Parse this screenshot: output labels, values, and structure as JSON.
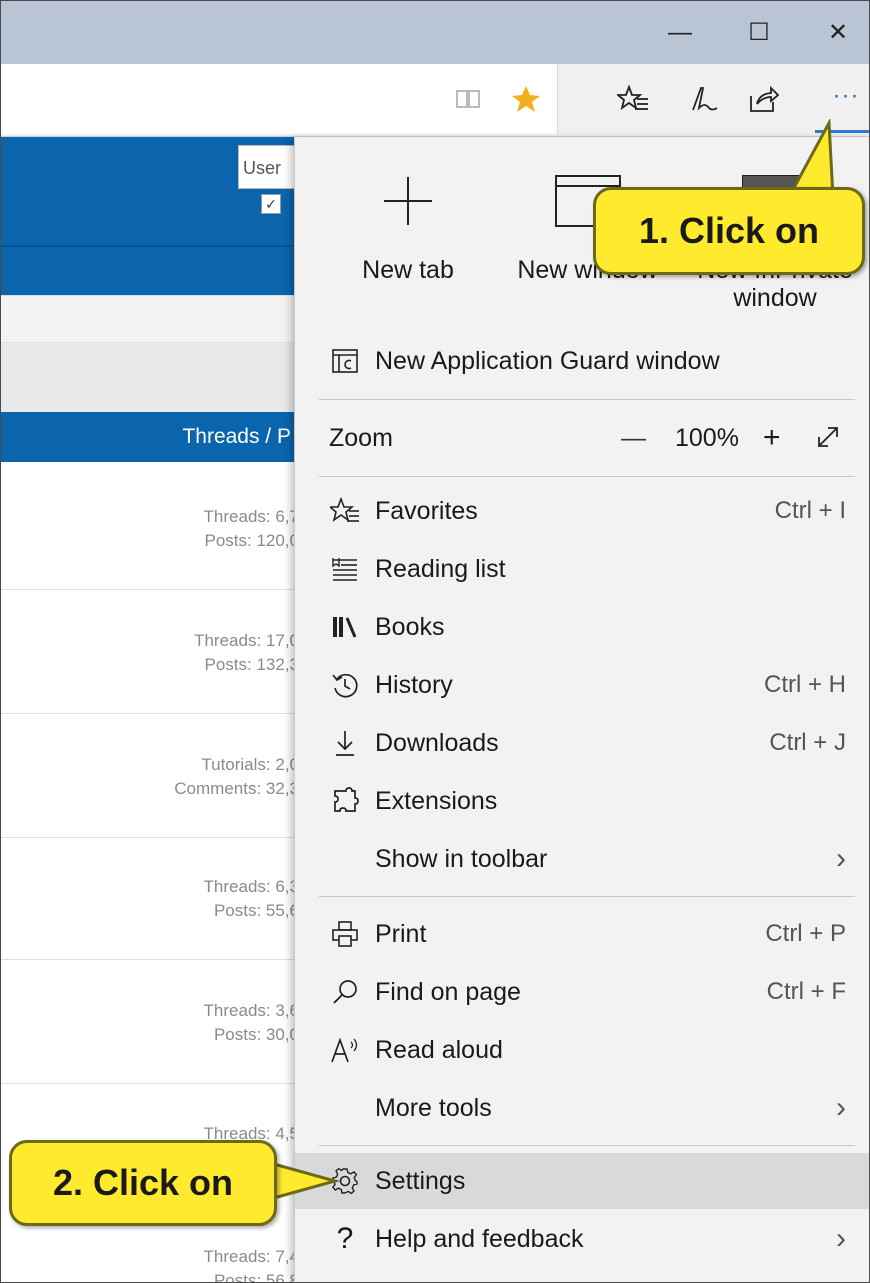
{
  "browser": {
    "minimize_glyph": "—",
    "maximize_glyph": "☐",
    "close_glyph": "✕",
    "more_glyph": "···"
  },
  "page": {
    "user_label": "User",
    "threads_header": "Threads / P",
    "stats": [
      [
        "Threads: 6,7",
        "Posts: 120,0"
      ],
      [
        "Threads: 17,0",
        "Posts: 132,3"
      ],
      [
        "Tutorials: 2,0",
        "Comments: 32,3"
      ],
      [
        "Threads: 6,3",
        "Posts: 55,6"
      ],
      [
        "Threads: 3,6",
        "Posts: 30,0"
      ],
      [
        "Threads: 4,5",
        ""
      ],
      [
        "Threads: 7,4",
        "Posts: 56,8"
      ]
    ]
  },
  "menu": {
    "new_tab": "New tab",
    "new_window": "New window",
    "new_inprivate": "New InPrivate",
    "new_inprivate_2": "window",
    "app_guard": "New Application Guard window",
    "zoom_label": "Zoom",
    "zoom_minus": "—",
    "zoom_value": "100%",
    "zoom_plus": "+",
    "favorites": "Favorites",
    "favorites_sc": "Ctrl + I",
    "reading_list": "Reading list",
    "books": "Books",
    "history": "History",
    "history_sc": "Ctrl + H",
    "downloads": "Downloads",
    "downloads_sc": "Ctrl + J",
    "extensions": "Extensions",
    "show_in_toolbar": "Show in toolbar",
    "print": "Print",
    "print_sc": "Ctrl + P",
    "find_on_page": "Find on page",
    "find_sc": "Ctrl + F",
    "read_aloud": "Read aloud",
    "more_tools": "More tools",
    "settings": "Settings",
    "help": "Help and feedback",
    "chevron": "›"
  },
  "callouts": {
    "one": "1. Click on",
    "two": "2. Click on"
  },
  "colors": {
    "callout_fill": "#ffea2e",
    "page_blue": "#0b65ad",
    "menu_bg": "#f2f2f2",
    "star": "#f2b01e"
  }
}
